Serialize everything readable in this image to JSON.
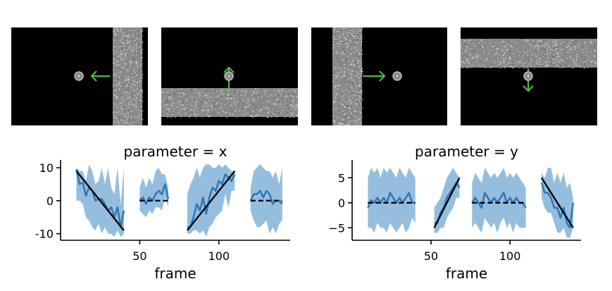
{
  "stimuli": {
    "colors": {
      "background": "#000000",
      "bar": "#8a8a8a",
      "arrow": "#4fc24f",
      "dot": "#bdbdbd"
    },
    "panels": [
      {
        "bar_orientation": "vertical",
        "arrow_direction": "left"
      },
      {
        "bar_orientation": "horizontal",
        "arrow_direction": "up"
      },
      {
        "bar_orientation": "vertical",
        "arrow_direction": "right"
      },
      {
        "bar_orientation": "horizontal",
        "arrow_direction": "down"
      }
    ]
  },
  "chart_data": [
    {
      "type": "line",
      "title": "parameter = x",
      "xlabel": "frame",
      "ylabel": "",
      "xlim": [
        0,
        145
      ],
      "ylim": [
        -12,
        11.5
      ],
      "xticks": [
        50,
        100
      ],
      "xtick_labels": [
        "50",
        "100"
      ],
      "yticks": [
        10,
        0,
        -10
      ],
      "ytick_labels": [
        "10",
        "0",
        "-10"
      ],
      "colors": {
        "band": "#8fbbdc",
        "mean": "#2f79b7",
        "target": "#000000"
      },
      "segments": [
        {
          "x": [
            10,
            12,
            14,
            16,
            18,
            20,
            22,
            24,
            26,
            28,
            30,
            32,
            34,
            36,
            38,
            40
          ],
          "mean": [
            9.5,
            5,
            5.5,
            1.5,
            4,
            3,
            0,
            0.5,
            0.5,
            -1,
            -3,
            -2,
            -5,
            -2,
            -8,
            -3
          ],
          "upper": [
            10,
            9,
            9,
            6,
            11,
            9,
            5,
            6,
            10,
            5,
            10,
            4,
            2,
            10,
            -1,
            10
          ],
          "lower": [
            0,
            0,
            -1,
            -5,
            -6,
            -8,
            -9,
            -7,
            -10,
            -8,
            -10,
            -10,
            -11,
            -9,
            -11,
            -10
          ],
          "target": [
            [
              10,
              9
            ],
            [
              40,
              -9
            ]
          ]
        },
        {
          "x": [
            50,
            52,
            54,
            56,
            58,
            60,
            62,
            64,
            66,
            68
          ],
          "mean": [
            0,
            1,
            -1,
            1,
            0,
            2,
            3,
            2,
            5,
            0.5
          ],
          "upper": [
            4,
            7,
            4,
            7,
            5,
            9,
            10,
            8,
            8,
            4
          ],
          "lower": [
            -3,
            -4,
            -5,
            -3,
            -4,
            -2,
            -2,
            -3,
            1,
            -2
          ],
          "target": [
            [
              50,
              0
            ],
            [
              68,
              0
            ]
          ]
        },
        {
          "x": [
            80,
            82,
            84,
            86,
            88,
            90,
            92,
            94,
            96,
            98,
            100,
            102,
            104,
            106,
            108,
            110
          ],
          "mean": [
            -8,
            -8,
            -5,
            -1,
            -3,
            1,
            -4,
            1,
            4,
            3,
            6,
            5,
            8,
            7,
            6,
            8
          ],
          "upper": [
            2,
            5,
            7,
            10,
            7,
            10,
            11,
            11,
            10,
            10,
            11,
            10,
            11,
            10,
            9,
            9
          ],
          "lower": [
            -10,
            -10,
            -9,
            -9,
            -10,
            -9,
            -11,
            -8,
            -7,
            -5,
            -4,
            -3,
            2,
            -2,
            3,
            3
          ],
          "target": [
            [
              80,
              -9
            ],
            [
              110,
              9
            ]
          ]
        },
        {
          "x": [
            120,
            122,
            124,
            126,
            128,
            130,
            132,
            134,
            136,
            138,
            140
          ],
          "mean": [
            0,
            2,
            2,
            3,
            1,
            3,
            2,
            -1,
            0,
            0,
            -1
          ],
          "upper": [
            4,
            9,
            10,
            11,
            10,
            9,
            9,
            7,
            9,
            5,
            10
          ],
          "lower": [
            -3,
            -6,
            -8,
            -8,
            -7,
            -6,
            -10,
            -8,
            -10,
            -7,
            -6
          ],
          "target": [
            [
              120,
              0
            ],
            [
              140,
              0
            ]
          ]
        }
      ]
    },
    {
      "type": "line",
      "title": "parameter = y",
      "xlabel": "frame",
      "ylabel": "",
      "xlim": [
        0,
        145
      ],
      "ylim": [
        -7.5,
        8
      ],
      "xticks": [
        50,
        100
      ],
      "xtick_labels": [
        "50",
        "100"
      ],
      "yticks": [
        5,
        0,
        -5
      ],
      "ytick_labels": [
        "5",
        "0",
        "−5"
      ],
      "colors": {
        "band": "#8fbbdc",
        "mean": "#2f79b7",
        "target": "#000000"
      },
      "segments": [
        {
          "x": [
            10,
            12,
            14,
            16,
            18,
            20,
            22,
            24,
            26,
            28,
            30,
            32,
            34,
            36,
            38,
            40
          ],
          "mean": [
            -1,
            0.5,
            0,
            1,
            0,
            1,
            0,
            2,
            1,
            0,
            1,
            0,
            1,
            2,
            0,
            0
          ],
          "upper": [
            5,
            7,
            6,
            7,
            5,
            7,
            6,
            7,
            6,
            5,
            7,
            6,
            5,
            7,
            6,
            5
          ],
          "lower": [
            -5,
            -5,
            -6,
            -4,
            -5,
            -5,
            -6,
            -4,
            -5,
            -6,
            -5,
            -4,
            -6,
            -5,
            -3,
            -4
          ],
          "target": [
            [
              10,
              0
            ],
            [
              40,
              0
            ]
          ]
        },
        {
          "x": [
            52,
            54,
            56,
            58,
            60,
            62,
            64,
            66,
            68
          ],
          "mean": [
            -4,
            -4,
            -2,
            -1,
            1,
            2,
            3,
            4,
            3
          ],
          "upper": [
            -1,
            0,
            1,
            3,
            5,
            6,
            7,
            6,
            5
          ],
          "lower": [
            -6,
            -6,
            -5,
            -5,
            -3,
            -2,
            -1,
            1,
            1
          ],
          "target": [
            [
              52,
              -5
            ],
            [
              68,
              5
            ]
          ]
        },
        {
          "x": [
            76,
            78,
            80,
            82,
            84,
            86,
            88,
            90,
            92,
            94,
            96,
            98,
            100,
            102,
            104,
            106,
            108,
            110
          ],
          "mean": [
            0,
            1,
            0,
            -1,
            2,
            1,
            0,
            1,
            0,
            1,
            2,
            0,
            1,
            0,
            1,
            0,
            0,
            -1
          ],
          "upper": [
            4,
            6,
            5,
            4,
            7,
            6,
            5,
            6,
            5,
            6,
            7,
            5,
            6,
            5,
            6,
            5,
            4,
            3
          ],
          "lower": [
            -5,
            -4,
            -5,
            -6,
            -3,
            -4,
            -5,
            -4,
            -6,
            -4,
            -3,
            -5,
            -4,
            -6,
            -4,
            -5,
            -5,
            -5
          ],
          "target": [
            [
              76,
              0
            ],
            [
              110,
              0
            ]
          ]
        },
        {
          "x": [
            120,
            122,
            124,
            126,
            128,
            130,
            132,
            134,
            136,
            138,
            140
          ],
          "mean": [
            4,
            2,
            2,
            1,
            -1,
            -1,
            -3,
            -1,
            -4,
            -5,
            0
          ],
          "upper": [
            6,
            5,
            7,
            7,
            4,
            6,
            4,
            6,
            3,
            4,
            1
          ],
          "lower": [
            1,
            -1,
            -2,
            -2,
            -4,
            -6,
            -6,
            -5,
            -7,
            -7,
            -5
          ],
          "target": [
            [
              120,
              5
            ],
            [
              140,
              -5
            ]
          ]
        }
      ]
    }
  ]
}
